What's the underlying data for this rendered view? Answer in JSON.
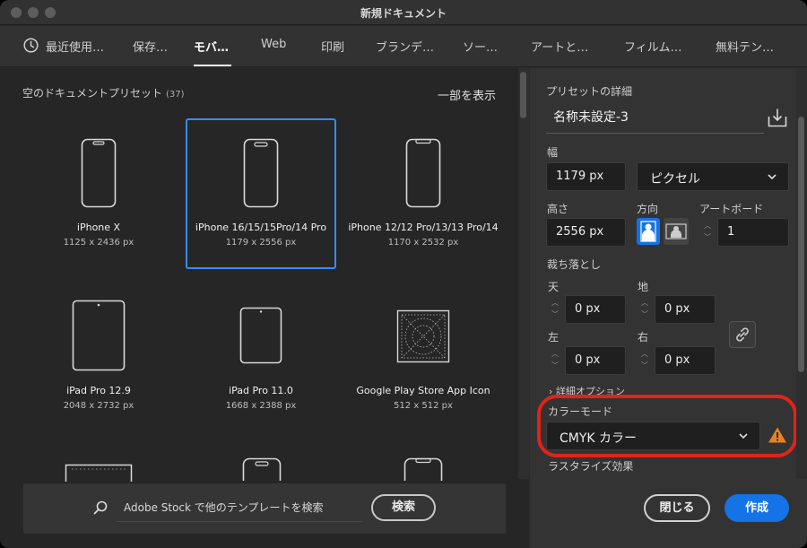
{
  "window": {
    "title": "新規ドキュメント"
  },
  "tabs": [
    {
      "label": "最近使用…",
      "icon": "clock-icon"
    },
    {
      "label": "保存…"
    },
    {
      "label": "モバ…",
      "active": true
    },
    {
      "label": "Web"
    },
    {
      "label": "印刷"
    },
    {
      "label": "ブランデ…"
    },
    {
      "label": "ソー…"
    },
    {
      "label": "アートと…"
    },
    {
      "label": "フィルム…"
    },
    {
      "label": "無料テン…"
    }
  ],
  "presets": {
    "section_title": "空のドキュメントプリセット",
    "count": "(37)",
    "show_more": "一部を表示",
    "items": [
      {
        "name": "iPhone X",
        "size": "1125 x 2436 px",
        "icon": "phone-icon"
      },
      {
        "name": "iPhone 16/15/15Pro/14 Pro",
        "size": "1179 x 2556 px",
        "icon": "phone-dynamic-island-icon",
        "selected": true
      },
      {
        "name": "iPhone 12/12 Pro/13/13 Pro/14",
        "size": "1170 x 2532 px",
        "icon": "phone-notch-icon"
      },
      {
        "name": "iPad Pro 12.9",
        "size": "2048 x 2732 px",
        "icon": "tablet-icon"
      },
      {
        "name": "iPad Pro 11.0",
        "size": "1668 x 2388 px",
        "icon": "tablet-small-icon"
      },
      {
        "name": "Google Play Store App Icon",
        "size": "512 x 512 px",
        "icon": "app-icon-grid-icon"
      }
    ]
  },
  "stock": {
    "placeholder": "Adobe Stock で他のテンプレートを検索",
    "button": "検索"
  },
  "details": {
    "heading": "プリセットの詳細",
    "name": "名称未設定-3",
    "width_label": "幅",
    "width": "1179 px",
    "unit": "ピクセル",
    "height_label": "高さ",
    "height": "2556 px",
    "orientation_label": "方向",
    "artboard_label": "アートボード",
    "artboard": "1",
    "bleed_label": "裁ち落とし",
    "top_label": "天",
    "top": "0 px",
    "bottom_label": "地",
    "bottom": "0 px",
    "left_label": "左",
    "left": "0 px",
    "right_label": "右",
    "right": "0 px",
    "advanced_label": "詳細オプション",
    "color_mode_label": "カラーモード",
    "color_mode": "CMYK カラー",
    "raster_label": "ラスタライズ効果"
  },
  "actions": {
    "close": "閉じる",
    "create": "作成"
  },
  "colors": {
    "accent": "#1473e6",
    "selection": "#3a8bff",
    "highlight": "#e02418",
    "warning": "#e6822a"
  }
}
